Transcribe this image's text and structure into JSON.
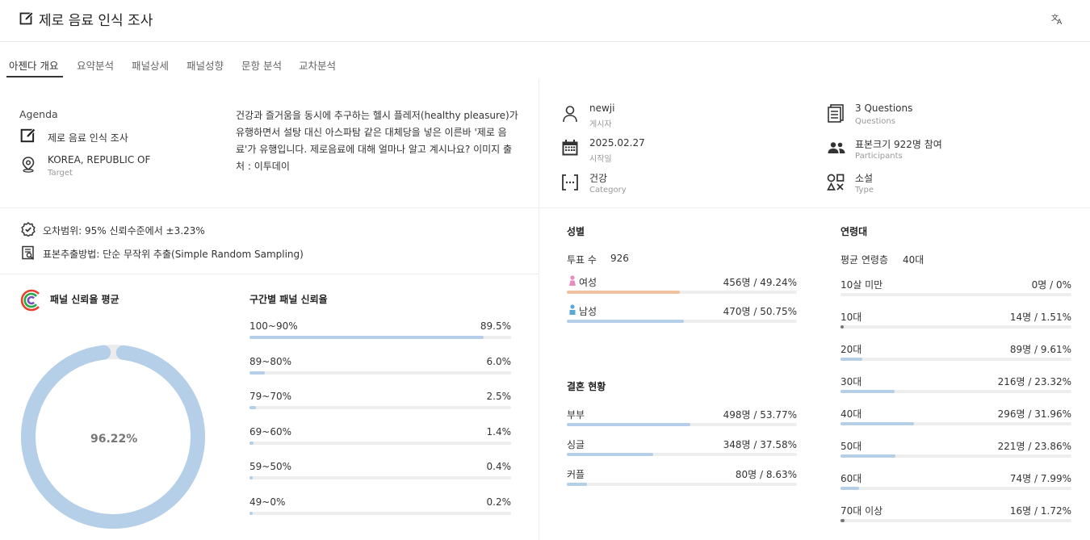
{
  "header": {
    "title": "제로 음료 인식 조사",
    "title_icon": "edit-icon",
    "translate_icon": "translate-icon"
  },
  "tabs": [
    {
      "label": "아젠다 개요",
      "active": true
    },
    {
      "label": "요약분석",
      "active": false
    },
    {
      "label": "패널상세",
      "active": false
    },
    {
      "label": "패널성향",
      "active": false
    },
    {
      "label": "문항 분석",
      "active": false
    },
    {
      "label": "교차분석",
      "active": false
    }
  ],
  "agenda": {
    "label": "Agenda",
    "name": "제로 음료 인식 조사",
    "target_value": "KOREA, REPUBLIC OF",
    "target_label": "Target",
    "description": "건강과 즐거움을 동시에 추구하는 헬시 플레저(healthy pleasure)가 유행하면서 설탕 대신 아스파탐 같은 대체당을 넣은 이른바 '제로 음료'가 유행입니다. 제로음료에 대해 얼마나 알고 계시나요? 이미지 출처 : 이투데이"
  },
  "meta": {
    "poster_value": "newji",
    "poster_label": "게시자",
    "start_value": "2025.02.27",
    "start_label": "시작일",
    "category_value": "건강",
    "category_label": "Category",
    "questions_value": "3 Questions",
    "questions_label": "Questions",
    "participants_value": "표본크기 922명 참여",
    "participants_label": "Participants",
    "type_value": "소설",
    "type_label": "Type"
  },
  "survey_info": {
    "error_range": "오차범위: 95% 신뢰수준에서 ±3.23%",
    "sampling_method": "표본추출방법: 단순 무작위 추출(Simple Random Sampling)"
  },
  "reliability": {
    "title": "패널 신뢰율 평균",
    "average": "96.22%",
    "average_fraction": 0.9622,
    "ring_color": "#b5cfe8",
    "track_color": "#ececec"
  },
  "reliability_ranges": {
    "title": "구간별 패널 신뢰율",
    "items": [
      {
        "label": "100~90%",
        "value": "89.5%",
        "fraction": 0.895
      },
      {
        "label": "89~80%",
        "value": "6.0%",
        "fraction": 0.06
      },
      {
        "label": "79~70%",
        "value": "2.5%",
        "fraction": 0.025
      },
      {
        "label": "69~60%",
        "value": "1.4%",
        "fraction": 0.014
      },
      {
        "label": "59~50%",
        "value": "0.4%",
        "fraction": 0.004
      },
      {
        "label": "49~0%",
        "value": "0.2%",
        "fraction": 0.002
      }
    ]
  },
  "gender": {
    "title": "성별",
    "vote_label": "투표 수",
    "vote_count": "926",
    "items": [
      {
        "label": "여성",
        "value": "456명 / 49.24%",
        "fraction": 0.4924,
        "color": "#f0c2a0",
        "icon": "female-icon",
        "icon_color": "#e88bbf"
      },
      {
        "label": "남성",
        "value": "470명 / 50.75%",
        "fraction": 0.5075,
        "color": "#b5cfe8",
        "icon": "male-icon",
        "icon_color": "#5aa8d8"
      }
    ]
  },
  "marriage": {
    "title": "결혼 현황",
    "items": [
      {
        "label": "부부",
        "value": "498명 / 53.77%",
        "fraction": 0.5377
      },
      {
        "label": "싱글",
        "value": "348명 / 37.58%",
        "fraction": 0.3758
      },
      {
        "label": "커플",
        "value": "80명 / 8.63%",
        "fraction": 0.0863
      }
    ]
  },
  "age": {
    "title": "연령대",
    "avg_label": "평균 연령층",
    "avg_value": "40대",
    "items": [
      {
        "label": "10살 미만",
        "value": "0명 / 0%",
        "fraction": 0.0
      },
      {
        "label": "10대",
        "value": "14명 / 1.51%",
        "fraction": 0.0151
      },
      {
        "label": "20대",
        "value": "89명 / 9.61%",
        "fraction": 0.0961
      },
      {
        "label": "30대",
        "value": "216명 / 23.32%",
        "fraction": 0.2332
      },
      {
        "label": "40대",
        "value": "296명 / 31.96%",
        "fraction": 0.3196
      },
      {
        "label": "50대",
        "value": "221명 / 23.86%",
        "fraction": 0.2386
      },
      {
        "label": "60대",
        "value": "74명 / 7.99%",
        "fraction": 0.0799
      },
      {
        "label": "70대 이상",
        "value": "16명 / 1.72%",
        "fraction": 0.0172
      }
    ]
  }
}
